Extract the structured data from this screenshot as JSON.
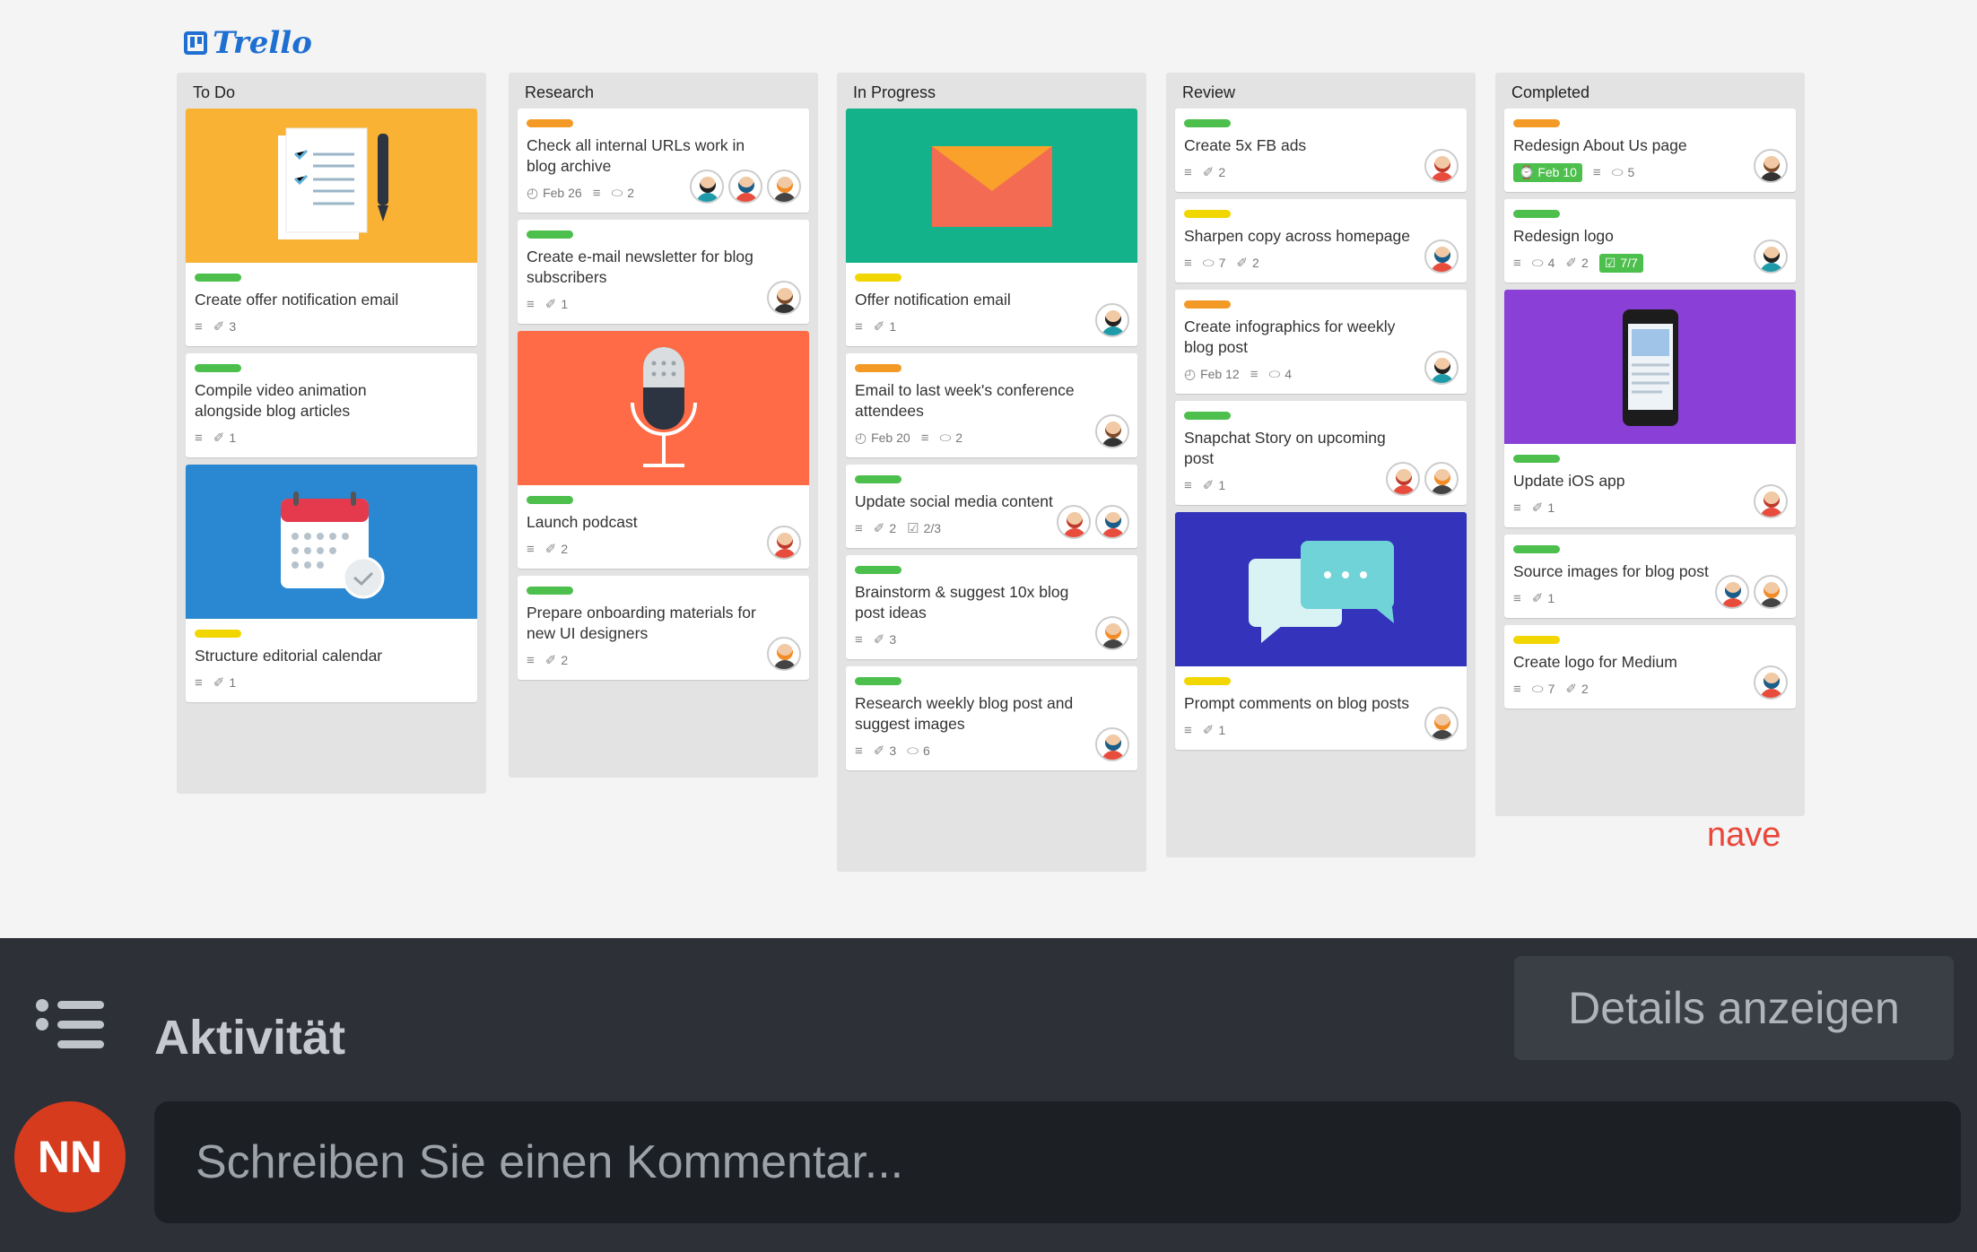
{
  "app": {
    "logo_text": "Trello",
    "watermark": "nave"
  },
  "lists": [
    {
      "title": "To Do",
      "cards": [
        {
          "cover": "clipboard-cover",
          "cover_color": "#f9b233",
          "label_color": "#4cbf4c",
          "title": "Create offer notification email",
          "desc": true,
          "attachments": "3"
        },
        {
          "label_color": "#4cbf4c",
          "title": "Compile video animation alongside blog articles",
          "desc": true,
          "attachments": "1"
        },
        {
          "cover": "calendar-cover",
          "cover_color": "#2a87d1",
          "label_color": "#f2d600",
          "title": "Structure editorial calendar",
          "desc": true,
          "attachments": "1"
        }
      ]
    },
    {
      "title": "Research",
      "cards": [
        {
          "label_color": "#f39a26",
          "title": "Check all internal URLs work in blog archive",
          "date": "Feb 26",
          "desc": true,
          "comments": "2",
          "avatars": [
            "a1",
            "a5",
            "a4"
          ]
        },
        {
          "label_color": "#4cbf4c",
          "title": "Create e-mail newsletter for blog subscribers",
          "desc": true,
          "attachments": "1",
          "avatars": [
            "a3"
          ]
        },
        {
          "cover": "microphone-cover",
          "cover_color": "#ff6b46",
          "label_color": "#4cbf4c",
          "title": "Launch podcast",
          "desc": true,
          "attachments": "2",
          "avatars": [
            "a2"
          ]
        },
        {
          "label_color": "#4cbf4c",
          "title": "Prepare onboarding materials for new UI designers",
          "desc": true,
          "attachments": "2",
          "avatars": [
            "a4"
          ]
        }
      ]
    },
    {
      "title": "In Progress",
      "cards": [
        {
          "cover": "envelope-cover",
          "cover_color": "#13b28a",
          "label_color": "#f2d600",
          "title": "Offer notification email",
          "desc": true,
          "attachments": "1",
          "avatars": [
            "a1"
          ]
        },
        {
          "label_color": "#f39a26",
          "title": "Email to last week's conference attendees",
          "date": "Feb 20",
          "desc": true,
          "comments": "2",
          "avatars": [
            "a3"
          ]
        },
        {
          "label_color": "#4cbf4c",
          "title": "Update social media content",
          "desc": true,
          "attachments": "2",
          "checklist": "2/3",
          "avatars": [
            "a2",
            "a5"
          ]
        },
        {
          "label_color": "#4cbf4c",
          "title": "Brainstorm & suggest 10x blog post ideas",
          "desc": true,
          "attachments": "3",
          "avatars": [
            "a4"
          ]
        },
        {
          "label_color": "#4cbf4c",
          "title": "Research weekly blog post and suggest images",
          "desc": true,
          "attachments": "3",
          "comments": "6",
          "avatars": [
            "a5"
          ]
        }
      ]
    },
    {
      "title": "Review",
      "cards": [
        {
          "label_color": "#4cbf4c",
          "title": "Create 5x FB ads",
          "desc": true,
          "attachments": "2",
          "avatars": [
            "a2"
          ]
        },
        {
          "label_color": "#f2d600",
          "title": "Sharpen copy across homepage",
          "desc": true,
          "comments": "7",
          "attachments": "2",
          "avatars": [
            "a5"
          ]
        },
        {
          "label_color": "#f39a26",
          "title": "Create infographics for weekly blog post",
          "date": "Feb 12",
          "desc": true,
          "comments": "4",
          "avatars": [
            "a1"
          ]
        },
        {
          "label_color": "#4cbf4c",
          "title": "Snapchat Story on upcoming post",
          "desc": true,
          "attachments": "1",
          "avatars": [
            "a2",
            "a4"
          ]
        },
        {
          "cover": "chat-cover",
          "cover_color": "#3333bb",
          "label_color": "#f2d600",
          "title": "Prompt comments on blog posts",
          "desc": true,
          "attachments": "1",
          "avatars": [
            "a4"
          ]
        }
      ]
    },
    {
      "title": "Completed",
      "cards": [
        {
          "label_color": "#f39a26",
          "title": "Redesign About Us page",
          "due_badge": "Feb 10",
          "desc": true,
          "comments": "5",
          "avatars": [
            "a3"
          ]
        },
        {
          "label_color": "#4cbf4c",
          "title": "Redesign logo",
          "desc": true,
          "comments": "4",
          "attachments": "2",
          "checklist_badge": "7/7",
          "avatars": [
            "a1"
          ]
        },
        {
          "cover": "phone-cover",
          "cover_color": "#8a3fd6",
          "label_color": "#4cbf4c",
          "title": "Update iOS app",
          "desc": true,
          "attachments": "1",
          "avatars": [
            "a2"
          ]
        },
        {
          "label_color": "#4cbf4c",
          "title": "Source images for blog post",
          "desc": true,
          "attachments": "1",
          "avatars": [
            "a5",
            "a4"
          ]
        },
        {
          "label_color": "#f2d600",
          "title": "Create logo for Medium",
          "desc": true,
          "comments": "7",
          "attachments": "2",
          "avatars": [
            "a5"
          ]
        }
      ]
    }
  ],
  "activity": {
    "title": "Aktivität",
    "details_button": "Details anzeigen",
    "user_initials": "NN",
    "comment_placeholder": "Schreiben Sie einen Kommentar..."
  },
  "colors": {
    "panel_bg": "#2d3137",
    "avatar_red": "#d63b1e"
  }
}
